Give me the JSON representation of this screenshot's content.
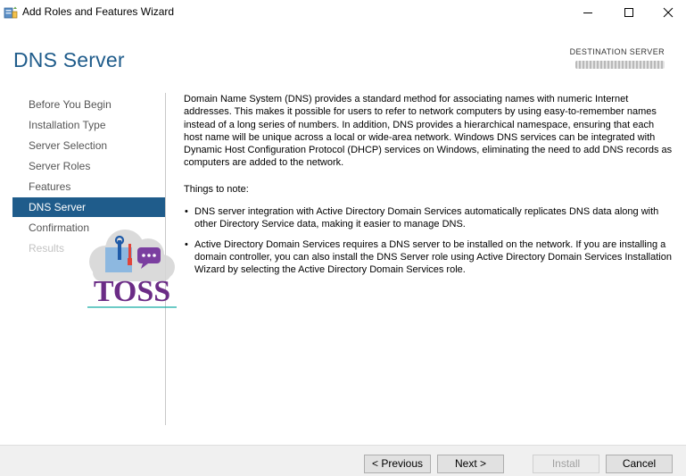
{
  "window": {
    "title": "Add Roles and Features Wizard",
    "app_icon": "server-manager-wizard-icon",
    "controls": {
      "minimize_icon": "minimize-icon",
      "maximize_icon": "maximize-icon",
      "close_icon": "close-icon"
    }
  },
  "header": {
    "page_title": "DNS Server",
    "destination_label": "DESTINATION SERVER"
  },
  "nav": {
    "items": [
      {
        "label": "Before You Begin",
        "state": "normal"
      },
      {
        "label": "Installation Type",
        "state": "normal"
      },
      {
        "label": "Server Selection",
        "state": "normal"
      },
      {
        "label": "Server Roles",
        "state": "normal"
      },
      {
        "label": "Features",
        "state": "normal"
      },
      {
        "label": "DNS Server",
        "state": "active"
      },
      {
        "label": "Confirmation",
        "state": "normal"
      },
      {
        "label": "Results",
        "state": "disabled"
      }
    ]
  },
  "watermark": {
    "logo_text": "TOSS",
    "logo_icon": "tools-chat-cloud-logo-icon"
  },
  "content": {
    "intro": "Domain Name System (DNS) provides a standard method for associating names with numeric Internet addresses. This makes it possible for users to refer to network computers by using easy-to-remember names instead of a long series of numbers. In addition, DNS provides a hierarchical namespace, ensuring that each host name will be unique across a local or wide-area network. Windows DNS services can be integrated with Dynamic Host Configuration Protocol (DHCP) services on Windows, eliminating the need to add DNS records as computers are added to the network.",
    "notes_title": "Things to note:",
    "notes": [
      "DNS server integration with Active Directory Domain Services automatically replicates DNS data along with other Directory Service data, making it easier to manage DNS.",
      "Active Directory Domain Services requires a DNS server to be installed on the network. If you are installing a domain controller, you can also install the DNS Server role using Active Directory Domain Services Installation Wizard by selecting the Active Directory Domain Services role."
    ]
  },
  "footer": {
    "previous_label": "< Previous",
    "next_label": "Next >",
    "install_label": "Install",
    "cancel_label": "Cancel"
  },
  "colors": {
    "accent": "#1f5c8b",
    "footer_bg": "#f0f0f0",
    "disabled_text": "#c3c3c3"
  }
}
